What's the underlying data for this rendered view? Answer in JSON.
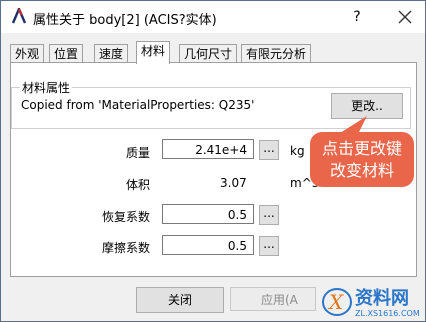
{
  "window": {
    "title": "属性关于 body[2] (ACIS?实体)",
    "help_label": "?",
    "close_icon": "close-icon"
  },
  "tabs": [
    "外观",
    "位置",
    "速度",
    "材料",
    "几何尺寸",
    "有限元分析"
  ],
  "active_tab": "材料",
  "material": {
    "group_title": "材料属性",
    "value": "Copied from 'MaterialProperties: Q235'",
    "change_button": "更改.."
  },
  "properties": {
    "mass": {
      "label": "质量",
      "value": "2.41e+4",
      "button": "...",
      "unit": "kg"
    },
    "volume": {
      "label": "体积",
      "value": "3.07",
      "unit": "m^3"
    },
    "restitution": {
      "label": "恢复系数",
      "value": "0.5",
      "button": "..."
    },
    "friction": {
      "label": "摩擦系数",
      "value": "0.5",
      "button": "..."
    }
  },
  "callout": {
    "line1": "点击更改键",
    "line2": "改变材料",
    "color": "#e9664a"
  },
  "footer": {
    "close_label": "关闭",
    "apply_label": "应用(A"
  },
  "watermark": {
    "brand": "资料网",
    "url": "ZL.XS1616.COM"
  }
}
